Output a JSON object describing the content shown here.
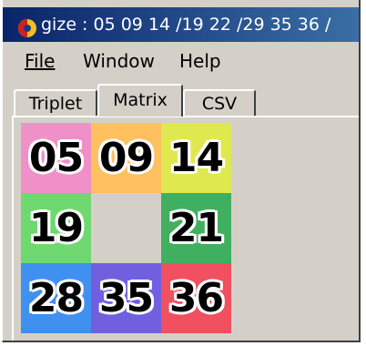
{
  "window": {
    "title": "gize : 05 09 14 /19 22 /29 35 36 /"
  },
  "menu": {
    "file": "File",
    "window": "Window",
    "help": "Help"
  },
  "tabs": [
    {
      "label": "Triplet",
      "active": false
    },
    {
      "label": "Matrix",
      "active": true
    },
    {
      "label": "CSV",
      "active": false
    }
  ],
  "matrix": {
    "cells": [
      {
        "value": "05",
        "color": "#f090c8"
      },
      {
        "value": "09",
        "color": "#ffc060"
      },
      {
        "value": "14",
        "color": "#e0e850"
      },
      {
        "value": "19",
        "color": "#70d870"
      },
      {
        "value": "",
        "color": "#d4d0c8"
      },
      {
        "value": "21",
        "color": "#40b060"
      },
      {
        "value": "28",
        "color": "#4090f0"
      },
      {
        "value": "35",
        "color": "#7060e0"
      },
      {
        "value": "36",
        "color": "#f05060"
      }
    ]
  },
  "colors": {
    "titlebar_start": "#0a246a",
    "titlebar_end": "#3a6ea5",
    "face": "#d4d0c8"
  },
  "icons": {
    "app": "app-logo-icon"
  }
}
